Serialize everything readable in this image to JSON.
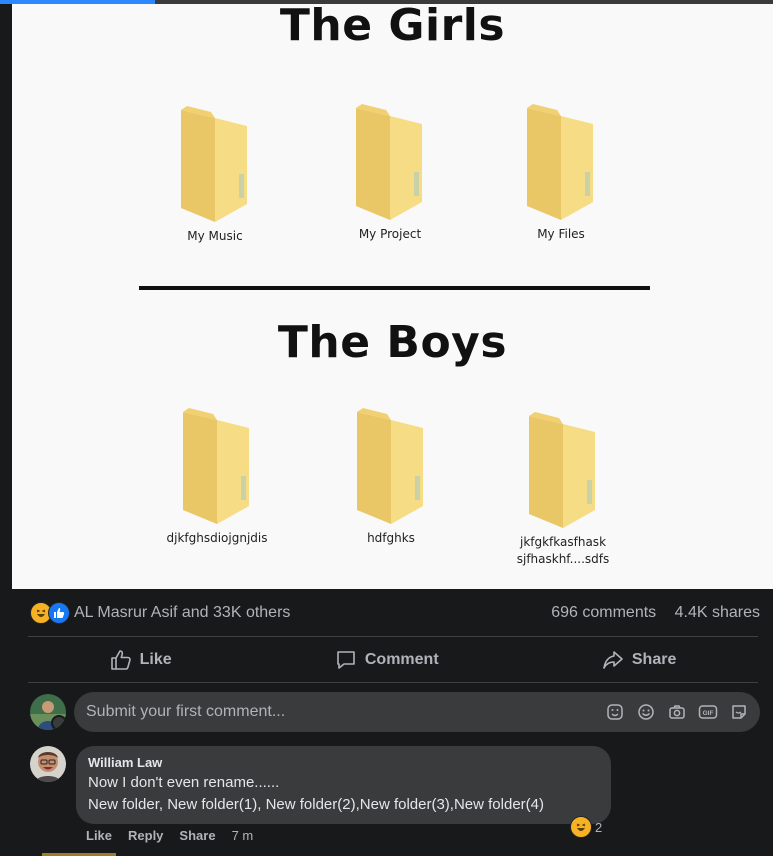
{
  "meme": {
    "girls_title": "The Girls",
    "boys_title": "The Boys",
    "girls_folders": [
      "My Music",
      "My Project",
      "My  Files"
    ],
    "boys_folders": [
      "djkfghsdiojgnjdis",
      "hdfghks",
      "jkfgkfkasfhask\nsjfhaskhf....sdfs"
    ]
  },
  "post": {
    "reactions_text": "AL Masrur Asif and 33K others",
    "comments_count": "696 comments",
    "shares_count": "4.4K shares",
    "reaction_icons": [
      "haha-icon",
      "like-icon"
    ]
  },
  "actions": {
    "like": "Like",
    "comment": "Comment",
    "share": "Share"
  },
  "composer": {
    "placeholder": "Submit your first comment...",
    "icons": [
      "sticker-icon",
      "emoji-icon",
      "camera-icon",
      "gif-icon",
      "avatar-sticker-icon"
    ]
  },
  "comment": {
    "author": "William Law",
    "line1": "Now I don't even rename......",
    "line2": "New folder, New folder(1), New folder(2),New folder(3),New folder(4)",
    "reaction_count": "2",
    "like": "Like",
    "reply": "Reply",
    "share": "Share",
    "time": "7 m"
  },
  "colors": {
    "background": "#18191a",
    "accent": "#2d88ff",
    "folder": "#f2d57a"
  },
  "progress": {
    "fraction": 0.2
  }
}
